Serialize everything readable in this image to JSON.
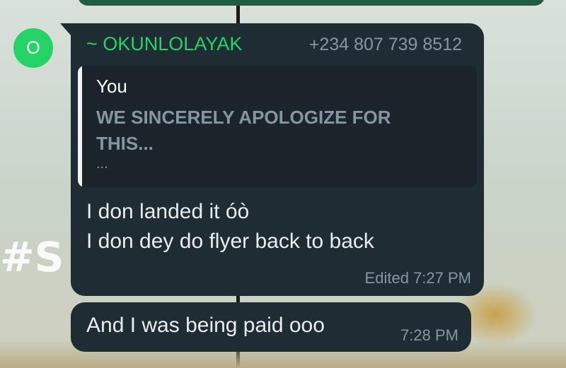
{
  "contact": {
    "avatar_initial": "O",
    "avatar_color": "#25d366"
  },
  "wallpaper": {
    "hash_text": "#S"
  },
  "messages": [
    {
      "sender_name": "~ OKUNLOLAYAK",
      "sender_phone": "+234 807 739 8512",
      "reply_to": {
        "author": "You",
        "text": "WE SINCERELY APOLOGIZE FOR THIS...",
        "ellipsis": "..."
      },
      "lines": [
        "I don landed it óò",
        "I don dey do flyer back to back"
      ],
      "edited_label": "Edited",
      "time": "7:27 PM"
    },
    {
      "text": "And I was being paid ooo",
      "time": "7:28 PM"
    }
  ],
  "colors": {
    "bubble_incoming": "#1f2c33",
    "sender_name": "#25d366",
    "meta_text": "#8696a0",
    "outgoing_bubble": "#1f5c40"
  }
}
